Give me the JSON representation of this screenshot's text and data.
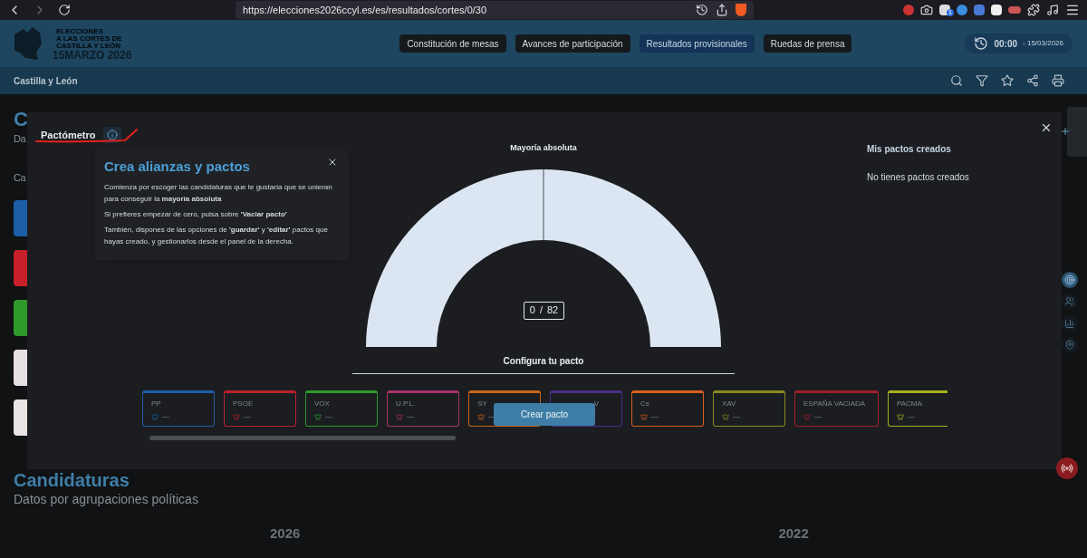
{
  "browser": {
    "url": "https://elecciones2026ccyl.es/es/resultados/cortes/0/30",
    "extension_badge": "1"
  },
  "header": {
    "logo_lines": [
      "ELECCIONES",
      "A LAS CORTES DE",
      "CASTILLA Y LEÓN"
    ],
    "logo_date": "15MARZO 2026",
    "nav": [
      {
        "label": "Constitución de mesas",
        "selected": false
      },
      {
        "label": "Avances de participación",
        "selected": false
      },
      {
        "label": "Resultados provisionales",
        "selected": true
      },
      {
        "label": "Ruedas de prensa",
        "selected": false
      }
    ],
    "clock": {
      "time": "00:00",
      "date": "- 15/03/2026"
    }
  },
  "subheader": {
    "title": "Castilla y León"
  },
  "page": {
    "heading": "C",
    "subheading": "Da",
    "section": "Ca",
    "party_logos": [
      {
        "color": "#1d5ea8"
      },
      {
        "color": "#c8202a"
      },
      {
        "color": "#2f9a2a"
      },
      {
        "color": "#e6e0e4"
      },
      {
        "color": "#e8e4e4"
      }
    ],
    "candidaturas": {
      "title": "Candidaturas",
      "subtitle": "Datos por agrupaciones políticas",
      "years": [
        "2026",
        "2022"
      ]
    }
  },
  "modal": {
    "title": "Pactómetro",
    "popover": {
      "title": "Crea alianzas y pactos",
      "paragraphs": [
        "Comienza por escoger las candidaturas que te gustaría que se unieran para conseguir la **mayoría absoluta**",
        "Si prefieres empezar de cero, pulsa sobre **'Vaciar pacto'**",
        "También, dispones de las opciones de **'guardar'** y **'editar'** pactos que hayas creado, y gestionarlos desde el panel de la derecha."
      ]
    },
    "gauge_title": "Mayoría absoluta",
    "seats": "0",
    "separator": "/",
    "majority": "82",
    "configure_title": "Configura tu pacto",
    "parties": [
      {
        "kind": "card",
        "name": "PP",
        "seats": "—",
        "color": "#1f5fa8"
      },
      {
        "kind": "card",
        "name": "PSOE",
        "seats": "—",
        "color": "#b8232c"
      },
      {
        "kind": "card",
        "name": "VOX",
        "seats": "—",
        "color": "#2f9a2a"
      },
      {
        "kind": "card",
        "name": "U.P.L.",
        "seats": "—",
        "color": "#a8306a"
      },
      {
        "kind": "card",
        "name": "SY",
        "seats": "—",
        "color": "#c8661a"
      },
      {
        "kind": "covered",
        "name": "V",
        "color": "#4a2e8a"
      },
      {
        "kind": "card",
        "name": "Cs",
        "seats": "—",
        "color": "#d8601c"
      },
      {
        "kind": "card",
        "name": "XAV",
        "seats": "—",
        "color": "#8a8a1f"
      },
      {
        "kind": "card",
        "name": "ESPAÑA VACIADA",
        "seats": "—",
        "color": "#a0202a"
      },
      {
        "kind": "card",
        "name": "PACMA",
        "seats": "—",
        "color": "#a8b020"
      }
    ],
    "create_button": "Crear pacto",
    "my_pacts_title": "Mis pactos creados",
    "my_pacts_empty": "No tienes pactos creados"
  }
}
